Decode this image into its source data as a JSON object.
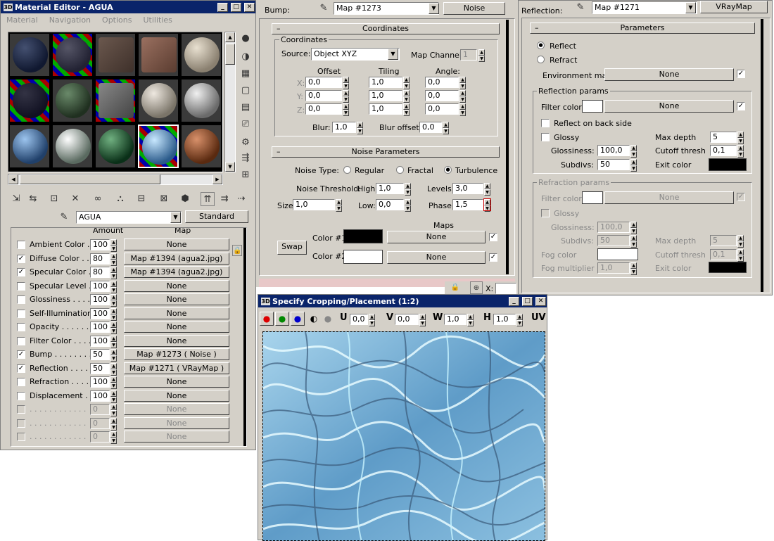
{
  "material_editor": {
    "title": "Material Editor - AGUA",
    "menu": [
      "Material",
      "Navigation",
      "Options",
      "Utilities"
    ],
    "material_name": "AGUA",
    "type_button": "Standard",
    "header_amount": "Amount",
    "header_map": "Map",
    "maps": [
      {
        "label": "Ambient Color . .",
        "checked": false,
        "amount": "100",
        "map": "None",
        "disabled": false
      },
      {
        "label": "Diffuse Color . . .",
        "checked": true,
        "amount": "80",
        "map": "Map #1394 (agua2.jpg)",
        "disabled": false
      },
      {
        "label": "Specular Color . .",
        "checked": true,
        "amount": "80",
        "map": "Map #1394 (agua2.jpg)",
        "disabled": false
      },
      {
        "label": "Specular Level . .",
        "checked": false,
        "amount": "100",
        "map": "None",
        "disabled": false
      },
      {
        "label": "Glossiness . . . . .",
        "checked": false,
        "amount": "100",
        "map": "None",
        "disabled": false
      },
      {
        "label": "Self-Illumination .",
        "checked": false,
        "amount": "100",
        "map": "None",
        "disabled": false
      },
      {
        "label": "Opacity . . . . . . .",
        "checked": false,
        "amount": "100",
        "map": "None",
        "disabled": false
      },
      {
        "label": "Filter Color . . . .",
        "checked": false,
        "amount": "100",
        "map": "None",
        "disabled": false
      },
      {
        "label": "Bump . . . . . . . .",
        "checked": true,
        "amount": "50",
        "map": "Map #1273  ( Noise )",
        "disabled": false
      },
      {
        "label": "Reflection . . . . .",
        "checked": true,
        "amount": "50",
        "map": "Map #1271  ( VRayMap )",
        "disabled": false
      },
      {
        "label": "Refraction . . . . .",
        "checked": false,
        "amount": "100",
        "map": "None",
        "disabled": false
      },
      {
        "label": "Displacement . .",
        "checked": false,
        "amount": "100",
        "map": "None",
        "disabled": false
      },
      {
        "label": ". . . . . . . . . . . .",
        "checked": false,
        "amount": "0",
        "map": "None",
        "disabled": true
      },
      {
        "label": ". . . . . . . . . . . .",
        "checked": false,
        "amount": "0",
        "map": "None",
        "disabled": true
      },
      {
        "label": ". . . . . . . . . . . .",
        "checked": false,
        "amount": "0",
        "map": "None",
        "disabled": true
      }
    ]
  },
  "bump_panel": {
    "bump_label": "Bump:",
    "map_name": "Map #1273",
    "type_button": "Noise",
    "coords_rollout": "Coordinates",
    "coords_group": "Coordinates",
    "source_label": "Source:",
    "source_value": "Object XYZ",
    "map_channel_label": "Map Channel:",
    "map_channel": "1",
    "offset_label": "Offset",
    "tiling_label": "Tiling",
    "angle_label": "Angle:",
    "rows": [
      {
        "axis": "X:",
        "offset": "0,0",
        "tiling": "1,0",
        "angle": "0,0"
      },
      {
        "axis": "Y:",
        "offset": "0,0",
        "tiling": "1,0",
        "angle": "0,0"
      },
      {
        "axis": "Z:",
        "offset": "0,0",
        "tiling": "1,0",
        "angle": "0,0"
      }
    ],
    "blur_label": "Blur:",
    "blur": "1,0",
    "blur_offset_label": "Blur offset:",
    "blur_offset": "0,0",
    "noise_rollout": "Noise Parameters",
    "noise_type_label": "Noise Type:",
    "noise_types": [
      "Regular",
      "Fractal",
      "Turbulence"
    ],
    "noise_selected": 2,
    "threshold_label": "Noise Threshold:",
    "high_label": "High:",
    "high": "1,0",
    "levels_label": "Levels:",
    "levels": "3,0",
    "size_label": "Size:",
    "size": "1,0",
    "low_label": "Low:",
    "low": "0,0",
    "phase_label": "Phase:",
    "phase": "1,5",
    "maps_label": "Maps",
    "swap_button": "Swap",
    "color1_label": "Color #1",
    "color1_map": "None",
    "color2_label": "Color #2",
    "color2_map": "None",
    "color1": "#000000",
    "color2": "#ffffff"
  },
  "reflection_panel": {
    "reflection_label": "Reflection:",
    "map_name": "Map #1271",
    "type_button": "VRayMap",
    "params_rollout": "Parameters",
    "reflect_label": "Reflect",
    "refract_label": "Refract",
    "env_map_label": "Environment map:",
    "env_map": "None",
    "refl_group": "Reflection params",
    "filter_color_label": "Filter color:",
    "filter_map": "None",
    "back_side_label": "Reflect on back side",
    "glossy_label": "Glossy",
    "max_depth_label": "Max depth",
    "max_depth": "5",
    "glossiness_label": "Glossiness:",
    "glossiness": "100,0",
    "cutoff_label": "Cutoff thresh",
    "cutoff": "0,1",
    "subdivs_label": "Subdivs:",
    "subdivs": "50",
    "exit_color_label": "Exit color",
    "refr_group": "Refraction params",
    "r_filter_color_label": "Filter color:",
    "r_filter_map": "None",
    "r_glossy_label": "Glossy",
    "r_glossiness_label": "Glossiness:",
    "r_glossiness": "100,0",
    "r_subdivs_label": "Subdivs:",
    "r_subdivs": "50",
    "r_max_depth_label": "Max depth",
    "r_max_depth": "5",
    "fog_color_label": "Fog color",
    "r_cutoff_label": "Cutoff thresh",
    "r_cutoff": "0,1",
    "fog_mult_label": "Fog multiplier",
    "fog_mult": "1,0",
    "r_exit_label": "Exit color"
  },
  "crop_window": {
    "title": "Specify Cropping/Placement (1:2)",
    "u_label": "U",
    "u": "0,0",
    "v_label": "V",
    "v": "0,0",
    "w_label": "W",
    "w": "1,0",
    "h_label": "H",
    "h": "1,0",
    "uv_label": "UV"
  },
  "colors": {
    "title_bar": "#0a246a",
    "panel": "#d4d0c8",
    "water": "#7ab4d8"
  }
}
